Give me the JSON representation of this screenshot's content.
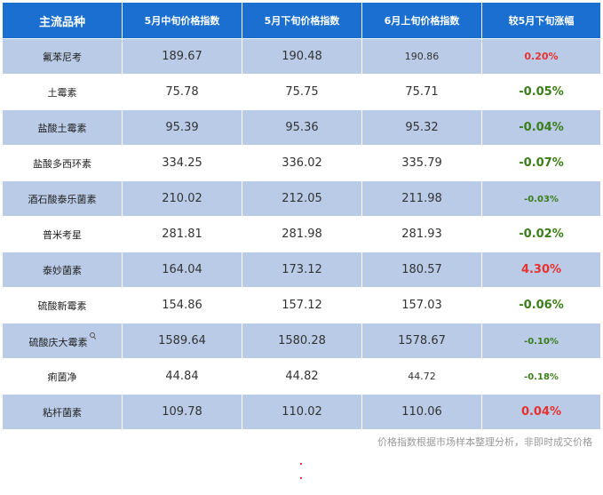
{
  "table": {
    "headers": [
      "主流品种",
      "5月中旬价格指数",
      "5月下旬价格指数",
      "6月上旬价格指数",
      "较5月下旬涨幅"
    ],
    "rows": [
      {
        "name": "氟苯尼考",
        "mid_may": "189.67",
        "late_may": "190.48",
        "early_june": "190.86",
        "change": "0.20%"
      },
      {
        "name": "土霉素",
        "mid_may": "75.78",
        "late_may": "75.75",
        "early_june": "75.71",
        "change": "-0.05%"
      },
      {
        "name": "盐酸土霉素",
        "mid_may": "95.39",
        "late_may": "95.36",
        "early_june": "95.32",
        "change": "-0.04%"
      },
      {
        "name": "盐酸多西环素",
        "mid_may": "334.25",
        "late_may": "336.02",
        "early_june": "335.79",
        "change": "-0.07%"
      },
      {
        "name": "酒石酸泰乐菌素",
        "mid_may": "210.02",
        "late_may": "212.05",
        "early_june": "211.98",
        "change": "-0.03%"
      },
      {
        "name": "普米考星",
        "mid_may": "281.81",
        "late_may": "281.98",
        "early_june": "281.93",
        "change": "-0.02%"
      },
      {
        "name": "泰妙菌素",
        "mid_may": "164.04",
        "late_may": "173.12",
        "early_june": "180.57",
        "change": "4.30%"
      },
      {
        "name": "硫酸新霉素",
        "mid_may": "154.86",
        "late_may": "157.12",
        "early_june": "157.03",
        "change": "-0.06%"
      },
      {
        "name": "硫酸庆大霉素",
        "mid_may": "1589.64",
        "late_may": "1580.28",
        "early_june": "1578.67",
        "change": "-0.10%"
      },
      {
        "name": "痢菌净",
        "mid_may": "44.84",
        "late_may": "44.82",
        "early_june": "44.72",
        "change": "-0.18%"
      },
      {
        "name": "粘杆菌素",
        "mid_may": "109.78",
        "late_may": "110.02",
        "early_june": "110.06",
        "change": "0.04%"
      }
    ]
  },
  "footnote": "价格指数根据市场样本整理分析，非即时成交价格",
  "colors": {
    "header_bg": "#1a6fd0",
    "stripe_bg": "#b9cbe6",
    "up": "#e8322f",
    "down": "#3a7d19"
  },
  "icons": {
    "row_9_name_suffix": "search-icon"
  }
}
